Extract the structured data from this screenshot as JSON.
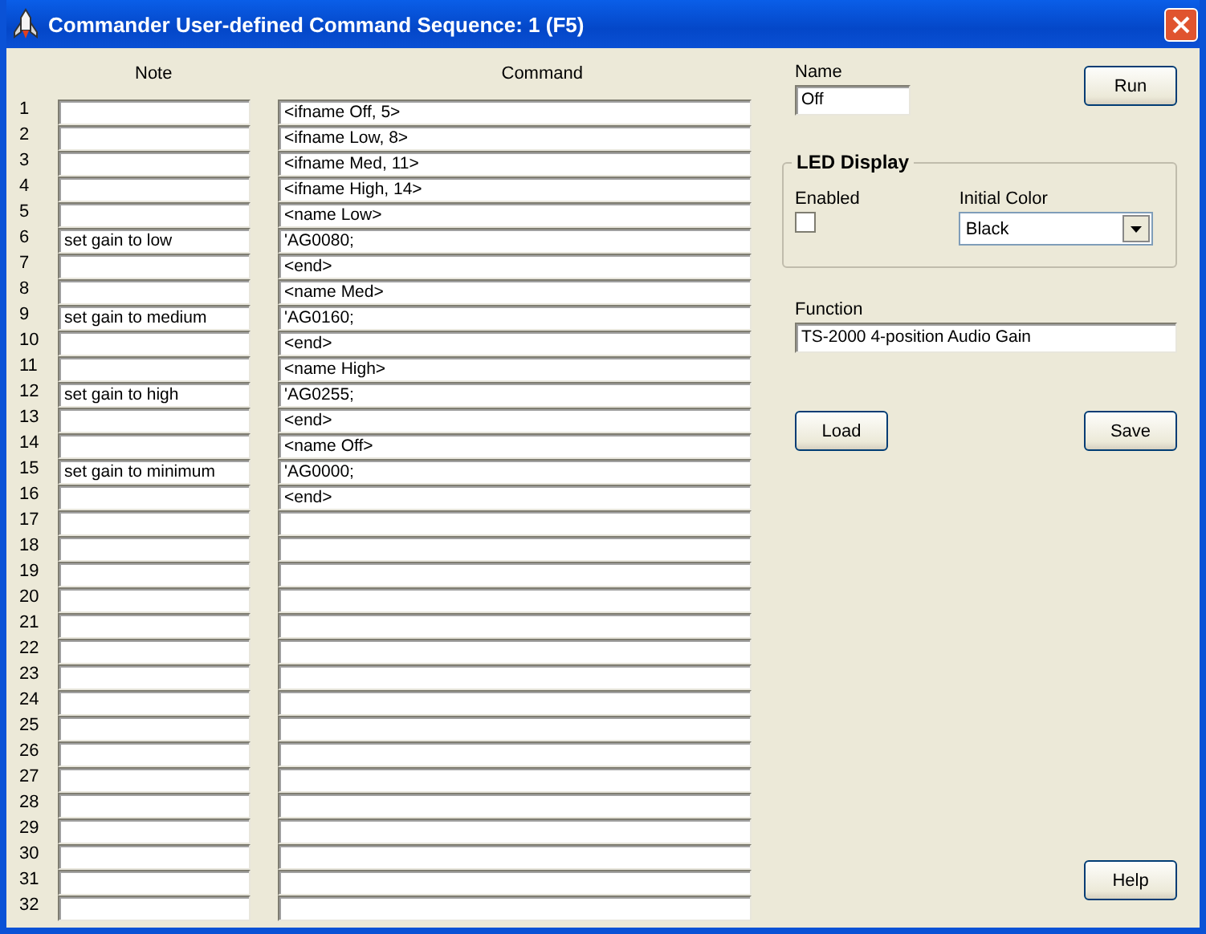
{
  "window": {
    "title": "Commander User-defined Command Sequence: 1 (F5)"
  },
  "columns": {
    "note": "Note",
    "command": "Command"
  },
  "rows": [
    {
      "number": "1",
      "command": "<ifname Off, 5>"
    },
    {
      "number": "2",
      "command": "<ifname Low, 8>"
    },
    {
      "number": "3",
      "command": "<ifname Med, 11>"
    },
    {
      "number": "4",
      "command": "<ifname High, 14>"
    },
    {
      "number": "5",
      "command": "<name Low>"
    },
    {
      "number": "6",
      "note": "set gain to low",
      "command": "'AG0080;"
    },
    {
      "number": "7",
      "command": "<end>"
    },
    {
      "number": "8",
      "command": "<name Med>"
    },
    {
      "number": "9",
      "note": "set gain to medium",
      "command": "'AG0160;"
    },
    {
      "number": "10",
      "command": "<end>"
    },
    {
      "number": "11",
      "command": "<name High>"
    },
    {
      "number": "12",
      "note": "set gain to high",
      "command": "'AG0255;"
    },
    {
      "number": "13",
      "command": "<end>"
    },
    {
      "number": "14",
      "command": "<name Off>"
    },
    {
      "number": "15",
      "note": "set gain to minimum",
      "command": "'AG0000;"
    },
    {
      "number": "16",
      "command": "<end>"
    },
    {
      "number": "17"
    },
    {
      "number": "18"
    },
    {
      "number": "19"
    },
    {
      "number": "20"
    },
    {
      "number": "21"
    },
    {
      "number": "22"
    },
    {
      "number": "23"
    },
    {
      "number": "24"
    },
    {
      "number": "25"
    },
    {
      "number": "26"
    },
    {
      "number": "27"
    },
    {
      "number": "28"
    },
    {
      "number": "29"
    },
    {
      "number": "30"
    },
    {
      "number": "31"
    },
    {
      "number": "32"
    }
  ],
  "name": {
    "label": "Name",
    "value": "Off"
  },
  "led_display": {
    "title": "LED Display",
    "enabled_label": "Enabled",
    "enabled_checked": false,
    "color_label": "Initial Color",
    "color_value": "Black"
  },
  "function": {
    "label": "Function",
    "value": "TS-2000 4-position Audio Gain"
  },
  "buttons": {
    "run": "Run",
    "load": "Load",
    "save": "Save",
    "help": "Help"
  }
}
